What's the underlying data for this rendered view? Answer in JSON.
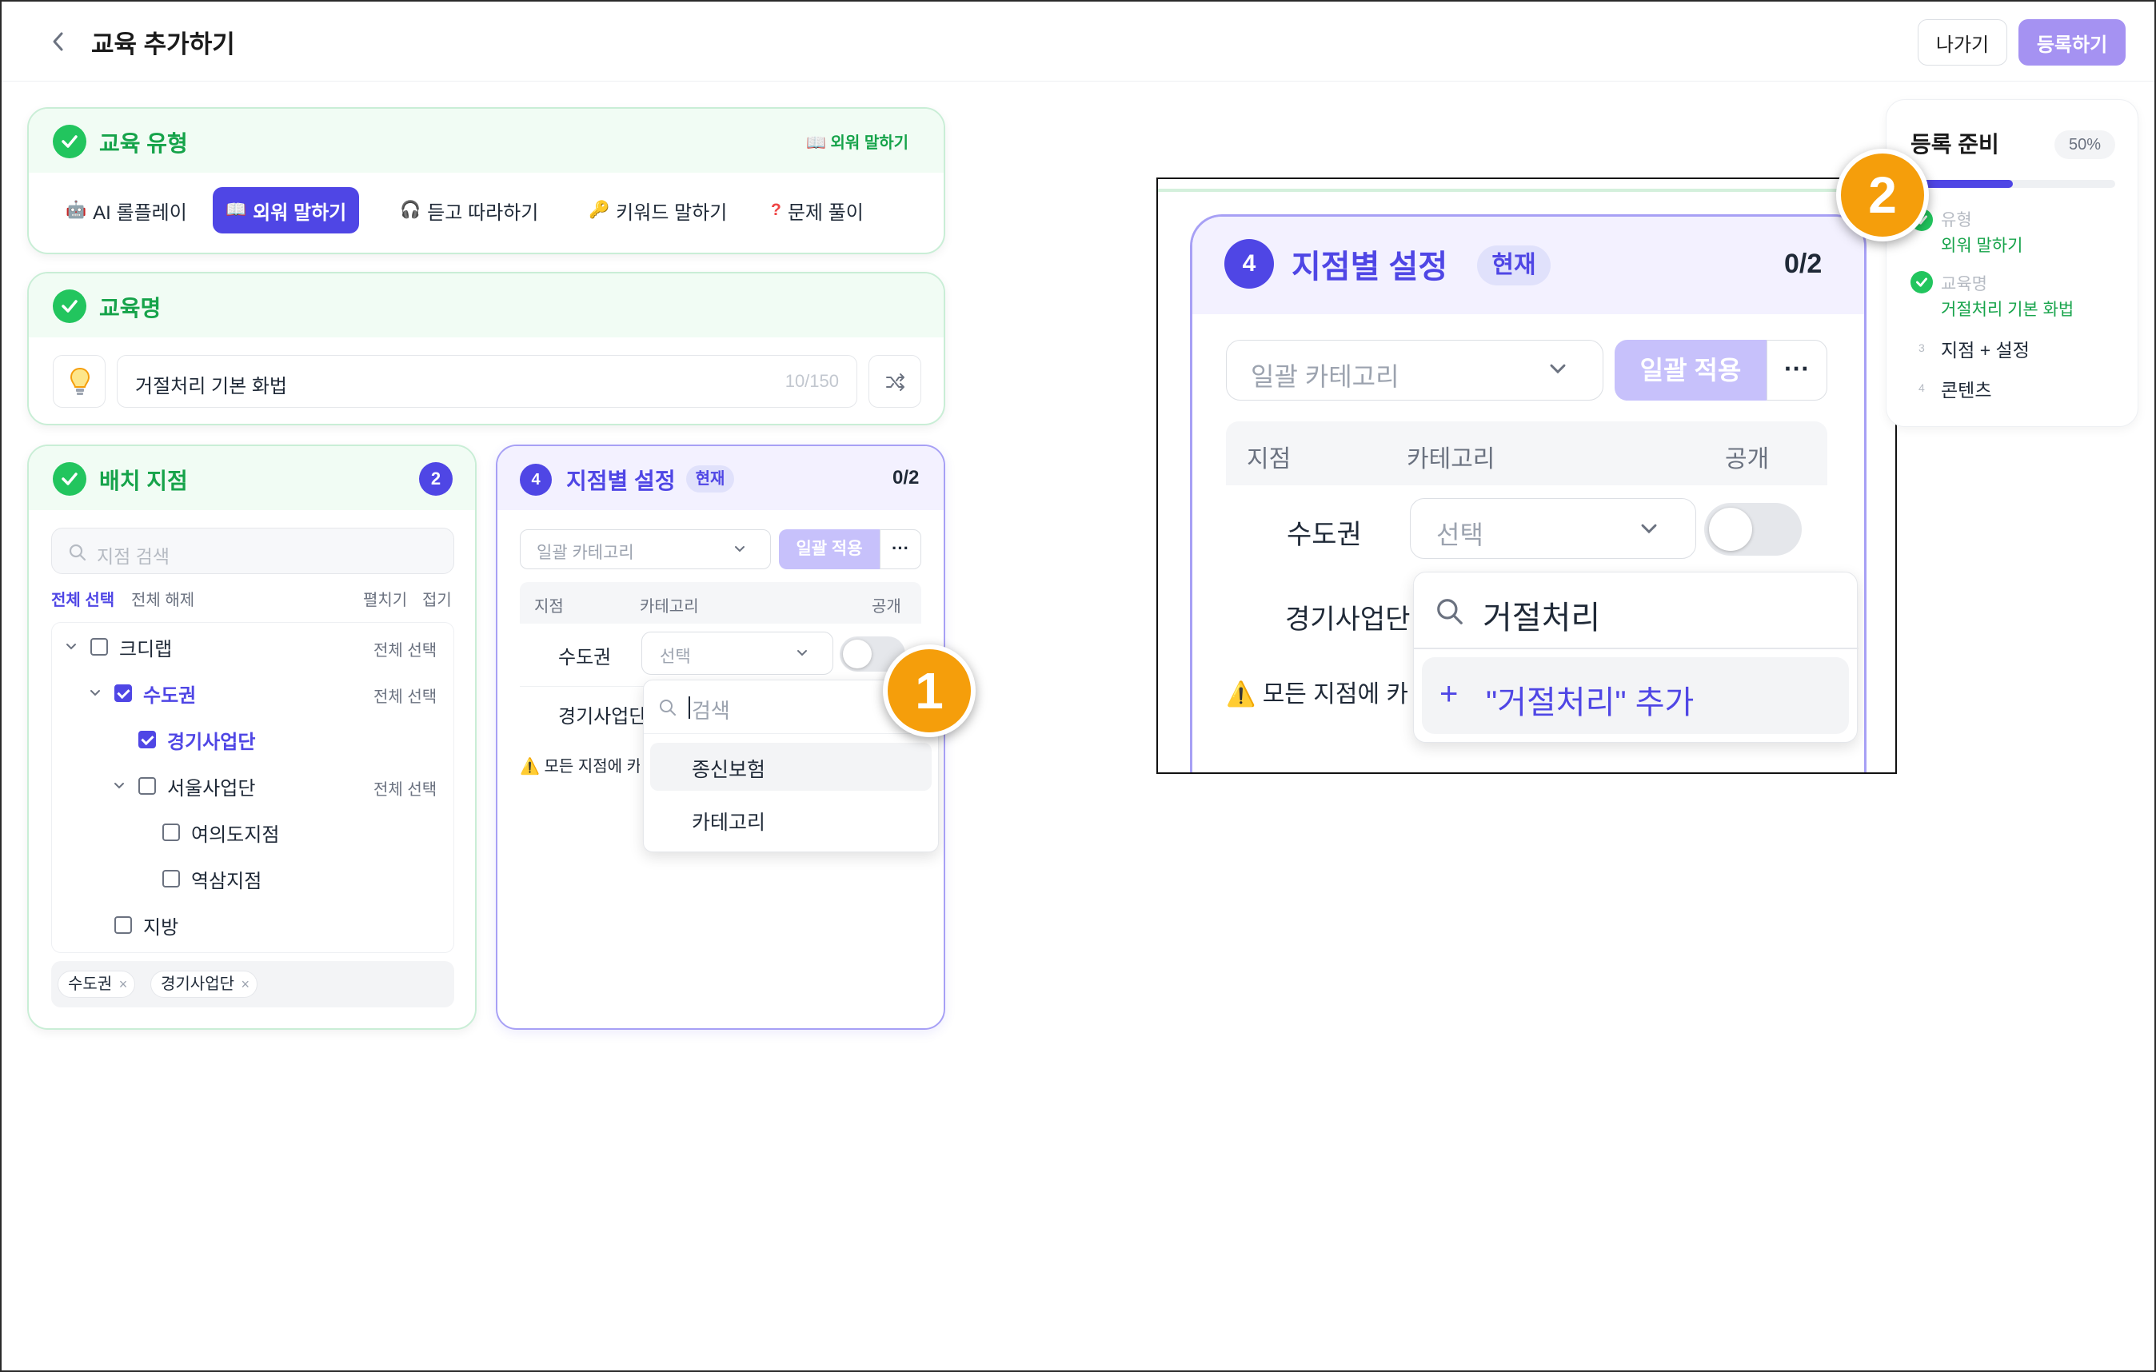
{
  "header": {
    "title": "교육 추가하기",
    "exit_label": "나가기",
    "register_label": "등록하기"
  },
  "edu_type": {
    "title": "교육 유형",
    "selected_tag": "외워 말하기",
    "tabs": [
      {
        "icon": "robot-icon",
        "label": "AI 롤플레이"
      },
      {
        "icon": "book-icon",
        "label": "외워 말하기"
      },
      {
        "icon": "headphones-icon",
        "label": "듣고 따라하기"
      },
      {
        "icon": "key-icon",
        "label": "키워드 말하기"
      },
      {
        "icon": "question-icon",
        "label": "문제 풀이"
      }
    ]
  },
  "edu_name": {
    "title": "교육명",
    "value": "거절처리 기본 화법",
    "count": "10/150"
  },
  "branches": {
    "title": "배치 지점",
    "count": "2",
    "search_placeholder": "지점 검색",
    "select_all": "전체 선택",
    "deselect_all": "전체 해제",
    "expand": "펼치기",
    "collapse": "접기",
    "row_select_all": "전체 선택",
    "tree": [
      {
        "label": "크디랩",
        "checked": false
      },
      {
        "label": "수도권",
        "checked": true
      },
      {
        "label": "경기사업단",
        "checked": true
      },
      {
        "label": "서울사업단",
        "checked": false
      },
      {
        "label": "여의도지점",
        "checked": false
      },
      {
        "label": "역삼지점",
        "checked": false
      },
      {
        "label": "지방",
        "checked": false
      }
    ],
    "chips": [
      "수도권",
      "경기사업단"
    ],
    "chip_remove": "×"
  },
  "branch_settings": {
    "step": "4",
    "title": "지점별 설정",
    "now_badge": "현재",
    "progress": "0/2",
    "bulk_category_placeholder": "일괄 카테고리",
    "bulk_apply": "일괄 적용",
    "more": "···",
    "columns": [
      "지점",
      "카테고리",
      "공개"
    ],
    "rows": [
      {
        "branch": "수도권",
        "category_placeholder": "선택",
        "public": false
      },
      {
        "branch": "경기사업단"
      }
    ],
    "warning_icon": "⚠️",
    "warning_text": "모든 지점에 카",
    "dropdown": {
      "search_placeholder": "검색",
      "options": [
        "종신보험",
        "카테고리"
      ]
    }
  },
  "zoom": {
    "row_branch_cut": "경기사업단",
    "warning_text": "모든 지점에 카",
    "search_value": "거절처리",
    "add_option": "\"거절처리\" 추가",
    "add_icon": "+"
  },
  "ready": {
    "title": "등록 준비",
    "percent": "50%",
    "progress": 0.5,
    "steps": [
      {
        "num": "1",
        "label": "유형",
        "sub": "외워 말하기"
      },
      {
        "num": "2",
        "label": "교육명",
        "sub": "거절처리 기본 화법"
      },
      {
        "num": "3",
        "label": "지점 + 설정"
      },
      {
        "num": "4",
        "label": "콘텐츠"
      }
    ]
  },
  "callouts": [
    "1",
    "2"
  ],
  "colors": {
    "accent": "#4f46e5",
    "success": "#22c55e",
    "callout": "#f59e0b",
    "register_button": "#a592f2"
  }
}
